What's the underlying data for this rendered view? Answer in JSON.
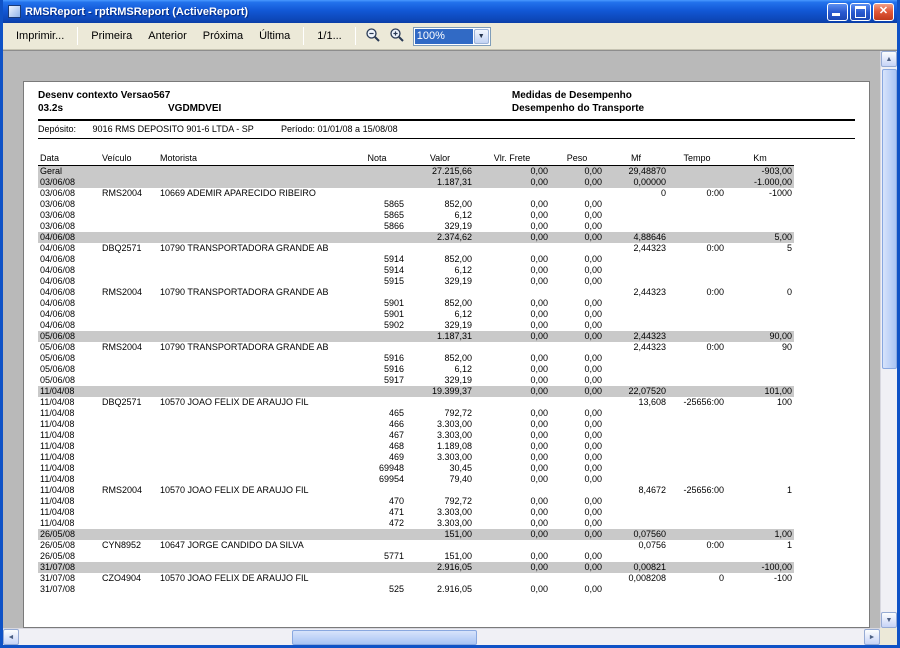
{
  "window": {
    "title": "RMSReport - rptRMSReport (ActiveReport)"
  },
  "toolbar": {
    "imprimir": "Imprimir...",
    "primeira": "Primeira",
    "anterior": "Anterior",
    "proxima": "Próxima",
    "ultima": "Última",
    "page_indicator": "1/1...",
    "zoom_value": "100%"
  },
  "icons": {
    "close": "✕",
    "combo_arrow": "▼",
    "scroll_up": "▲",
    "scroll_down": "▼",
    "scroll_left": "◄",
    "scroll_right": "►"
  },
  "colors": {
    "titlebar": "#1258d6",
    "selection": "#316ac5",
    "band": "#c9c9c9"
  },
  "report": {
    "header": {
      "title_left": "Desenv contexto Versao567",
      "version": "03.2s",
      "code": "VGDMDVEI",
      "title_right1": "Medidas de Desempenho",
      "title_right2": "Desempenho do Transporte",
      "deposito_label": "Depósito:",
      "deposito_value": "9016  RMS DEPOSITO 901-6 LTDA -  SP",
      "periodo": "Período: 01/01/08 a 15/08/08"
    },
    "columns": [
      "Data",
      "Veículo",
      "Motorista",
      "Nota",
      "Valor",
      "Vlr. Frete",
      "Peso",
      "Mf",
      "Tempo",
      "Km"
    ],
    "rows": [
      {
        "type": "total",
        "data": "Geral",
        "valor": "27.215,66",
        "frete": "0,00",
        "peso": "0,00",
        "mf": "29,48870",
        "km": "-903,00"
      },
      {
        "type": "group",
        "data": "03/06/08",
        "valor": "1.187,31",
        "frete": "0,00",
        "peso": "0,00",
        "mf": "0,00000",
        "km": "-1.000,00"
      },
      {
        "type": "veh",
        "data": "03/06/08",
        "veiculo": "RMS2004",
        "motorista": "10669 ADEMIR APARECIDO RIBEIRO",
        "mf": "0",
        "tempo": "0:00",
        "km": "-1000"
      },
      {
        "type": "det",
        "data": "03/06/08",
        "nota": "5865",
        "valor": "852,00",
        "frete": "0,00",
        "peso": "0,00"
      },
      {
        "type": "det",
        "data": "03/06/08",
        "nota": "5865",
        "valor": "6,12",
        "frete": "0,00",
        "peso": "0,00"
      },
      {
        "type": "det",
        "data": "03/06/08",
        "nota": "5866",
        "valor": "329,19",
        "frete": "0,00",
        "peso": "0,00"
      },
      {
        "type": "group",
        "data": "04/06/08",
        "valor": "2.374,62",
        "frete": "0,00",
        "peso": "0,00",
        "mf": "4,88646",
        "km": "5,00"
      },
      {
        "type": "veh",
        "data": "04/06/08",
        "veiculo": "DBQ2571",
        "motorista": "10790 TRANSPORTADORA GRANDE AB",
        "mf": "2,44323",
        "tempo": "0:00",
        "km": "5"
      },
      {
        "type": "det",
        "data": "04/06/08",
        "nota": "5914",
        "valor": "852,00",
        "frete": "0,00",
        "peso": "0,00"
      },
      {
        "type": "det",
        "data": "04/06/08",
        "nota": "5914",
        "valor": "6,12",
        "frete": "0,00",
        "peso": "0,00"
      },
      {
        "type": "det",
        "data": "04/06/08",
        "nota": "5915",
        "valor": "329,19",
        "frete": "0,00",
        "peso": "0,00"
      },
      {
        "type": "veh",
        "data": "04/06/08",
        "veiculo": "RMS2004",
        "motorista": "10790 TRANSPORTADORA GRANDE AB",
        "mf": "2,44323",
        "tempo": "0:00",
        "km": "0"
      },
      {
        "type": "det",
        "data": "04/06/08",
        "nota": "5901",
        "valor": "852,00",
        "frete": "0,00",
        "peso": "0,00"
      },
      {
        "type": "det",
        "data": "04/06/08",
        "nota": "5901",
        "valor": "6,12",
        "frete": "0,00",
        "peso": "0,00"
      },
      {
        "type": "det",
        "data": "04/06/08",
        "nota": "5902",
        "valor": "329,19",
        "frete": "0,00",
        "peso": "0,00"
      },
      {
        "type": "group",
        "data": "05/06/08",
        "valor": "1.187,31",
        "frete": "0,00",
        "peso": "0,00",
        "mf": "2,44323",
        "km": "90,00"
      },
      {
        "type": "veh",
        "data": "05/06/08",
        "veiculo": "RMS2004",
        "motorista": "10790 TRANSPORTADORA GRANDE AB",
        "mf": "2,44323",
        "tempo": "0:00",
        "km": "90"
      },
      {
        "type": "det",
        "data": "05/06/08",
        "nota": "5916",
        "valor": "852,00",
        "frete": "0,00",
        "peso": "0,00"
      },
      {
        "type": "det",
        "data": "05/06/08",
        "nota": "5916",
        "valor": "6,12",
        "frete": "0,00",
        "peso": "0,00"
      },
      {
        "type": "det",
        "data": "05/06/08",
        "nota": "5917",
        "valor": "329,19",
        "frete": "0,00",
        "peso": "0,00"
      },
      {
        "type": "group",
        "data": "11/04/08",
        "valor": "19.399,37",
        "frete": "0,00",
        "peso": "0,00",
        "mf": "22,07520",
        "km": "101,00"
      },
      {
        "type": "veh",
        "data": "11/04/08",
        "veiculo": "DBQ2571",
        "motorista": "10570 JOAO FELIX DE ARAUJO FIL",
        "mf": "13,608",
        "tempo": "-25656:00",
        "km": "100"
      },
      {
        "type": "det",
        "data": "11/04/08",
        "nota": "465",
        "valor": "792,72",
        "frete": "0,00",
        "peso": "0,00"
      },
      {
        "type": "det",
        "data": "11/04/08",
        "nota": "466",
        "valor": "3.303,00",
        "frete": "0,00",
        "peso": "0,00"
      },
      {
        "type": "det",
        "data": "11/04/08",
        "nota": "467",
        "valor": "3.303,00",
        "frete": "0,00",
        "peso": "0,00"
      },
      {
        "type": "det",
        "data": "11/04/08",
        "nota": "468",
        "valor": "1.189,08",
        "frete": "0,00",
        "peso": "0,00"
      },
      {
        "type": "det",
        "data": "11/04/08",
        "nota": "469",
        "valor": "3.303,00",
        "frete": "0,00",
        "peso": "0,00"
      },
      {
        "type": "det",
        "data": "11/04/08",
        "nota": "69948",
        "valor": "30,45",
        "frete": "0,00",
        "peso": "0,00"
      },
      {
        "type": "det",
        "data": "11/04/08",
        "nota": "69954",
        "valor": "79,40",
        "frete": "0,00",
        "peso": "0,00"
      },
      {
        "type": "veh",
        "data": "11/04/08",
        "veiculo": "RMS2004",
        "motorista": "10570 JOAO FELIX DE ARAUJO FIL",
        "mf": "8,4672",
        "tempo": "-25656:00",
        "km": "1"
      },
      {
        "type": "det",
        "data": "11/04/08",
        "nota": "470",
        "valor": "792,72",
        "frete": "0,00",
        "peso": "0,00"
      },
      {
        "type": "det",
        "data": "11/04/08",
        "nota": "471",
        "valor": "3.303,00",
        "frete": "0,00",
        "peso": "0,00"
      },
      {
        "type": "det",
        "data": "11/04/08",
        "nota": "472",
        "valor": "3.303,00",
        "frete": "0,00",
        "peso": "0,00"
      },
      {
        "type": "group",
        "data": "26/05/08",
        "valor": "151,00",
        "frete": "0,00",
        "peso": "0,00",
        "mf": "0,07560",
        "km": "1,00"
      },
      {
        "type": "veh",
        "data": "26/05/08",
        "veiculo": "CYN8952",
        "motorista": "10647 JORGE CANDIDO DA SILVA",
        "mf": "0,0756",
        "tempo": "0:00",
        "km": "1"
      },
      {
        "type": "det",
        "data": "26/05/08",
        "nota": "5771",
        "valor": "151,00",
        "frete": "0,00",
        "peso": "0,00"
      },
      {
        "type": "group",
        "data": "31/07/08",
        "valor": "2.916,05",
        "frete": "0,00",
        "peso": "0,00",
        "mf": "0,00821",
        "km": "-100,00"
      },
      {
        "type": "veh",
        "data": "31/07/08",
        "veiculo": "CZO4904",
        "motorista": "10570 JOAO FELIX DE ARAUJO FIL",
        "mf": "0,008208",
        "tempo": "0",
        "km": "-100"
      },
      {
        "type": "det",
        "data": "31/07/08",
        "nota": "525",
        "valor": "2.916,05",
        "frete": "0,00",
        "peso": "0,00"
      }
    ]
  }
}
